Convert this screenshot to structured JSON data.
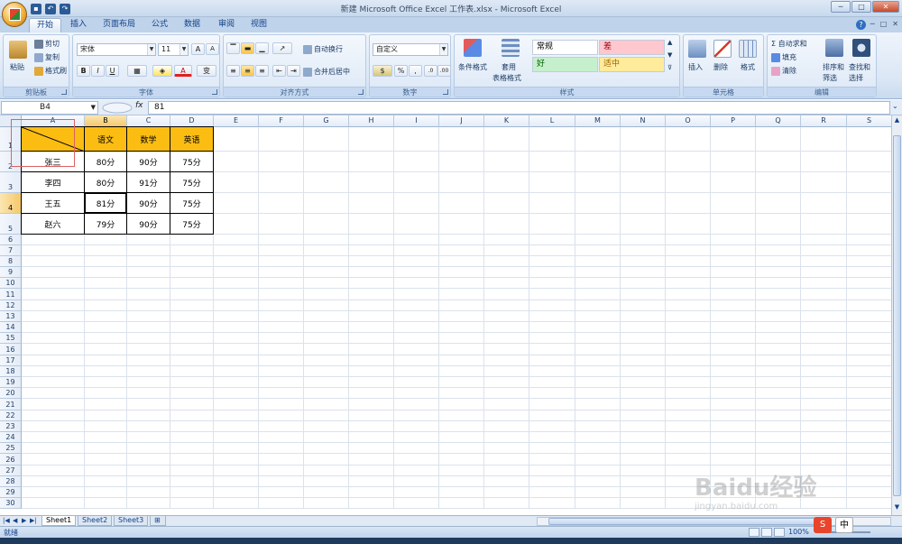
{
  "window": {
    "title": "新建 Microsoft Office Excel 工作表.xlsx - Microsoft Excel",
    "controls": [
      "─",
      "□",
      "✕"
    ]
  },
  "qat": [
    "保存",
    "撤销",
    "恢复"
  ],
  "tabs": [
    "开始",
    "插入",
    "页面布局",
    "公式",
    "数据",
    "审阅",
    "视图"
  ],
  "ribbon": {
    "clipboard": {
      "label": "剪贴板",
      "paste": "粘贴",
      "cut": "剪切",
      "copy": "复制",
      "format_painter": "格式刷"
    },
    "font": {
      "label": "字体",
      "font_name": "宋体",
      "font_size": "11",
      "bold": "B",
      "italic": "I",
      "underline": "U",
      "grow": "A",
      "shrink": "A",
      "wen": "变"
    },
    "alignment": {
      "label": "对齐方式",
      "wrap": "自动换行",
      "merge": "合并后居中"
    },
    "number": {
      "label": "数字",
      "format": "自定义",
      "currency": "%",
      "comma": ",",
      "inc": ".0",
      "dec": ".00"
    },
    "styles": {
      "label": "样式",
      "conditional": "条件格式",
      "table_format_1": "套用",
      "table_format_2": "表格格式",
      "cells": [
        {
          "name": "常规",
          "bg": "#ffffff",
          "color": "#000000"
        },
        {
          "name": "差",
          "bg": "#ffc7ce",
          "color": "#9c0006"
        },
        {
          "name": "好",
          "bg": "#c6efce",
          "color": "#006100"
        },
        {
          "name": "适中",
          "bg": "#ffeb9c",
          "color": "#9c6500"
        }
      ]
    },
    "cells_group": {
      "label": "单元格",
      "insert": "插入",
      "delete": "删除",
      "format": "格式"
    },
    "editing": {
      "label": "编辑",
      "autosum": "自动求和",
      "fill": "填充",
      "clear": "清除",
      "sort_filter_1": "排序和",
      "sort_filter_2": "筛选",
      "find_1": "查找和",
      "find_2": "选择"
    }
  },
  "formula_bar": {
    "name_box": "B4",
    "fx": "fx",
    "value": "81"
  },
  "columns": [
    "A",
    "B",
    "C",
    "D",
    "E",
    "F",
    "G",
    "H",
    "I",
    "J",
    "K",
    "L",
    "M",
    "N",
    "O",
    "P",
    "Q",
    "R",
    "S"
  ],
  "rows": [
    "1",
    "2",
    "3",
    "4",
    "5",
    "6",
    "7",
    "8",
    "9",
    "10",
    "11",
    "12",
    "13",
    "14",
    "15",
    "16",
    "17",
    "18",
    "19",
    "20",
    "21",
    "22",
    "23",
    "24",
    "25",
    "26",
    "27",
    "28",
    "29",
    "30"
  ],
  "table": {
    "headers": [
      "",
      "语文",
      "数学",
      "英语"
    ],
    "data": [
      [
        "张三",
        "80分",
        "90分",
        "75分"
      ],
      [
        "李四",
        "80分",
        "91分",
        "75分"
      ],
      [
        "王五",
        "81分",
        "90分",
        "75分"
      ],
      [
        "赵六",
        "79分",
        "90分",
        "75分"
      ]
    ],
    "header_bg": "#fbbd12"
  },
  "sheets": [
    "Sheet1",
    "Sheet2",
    "Sheet3"
  ],
  "status": {
    "text": "就绪",
    "zoom": "100%"
  },
  "ime": [
    "S",
    "中"
  ],
  "watermark": {
    "brand": "Baidu经验",
    "url": "jingyan.baidu.com"
  }
}
